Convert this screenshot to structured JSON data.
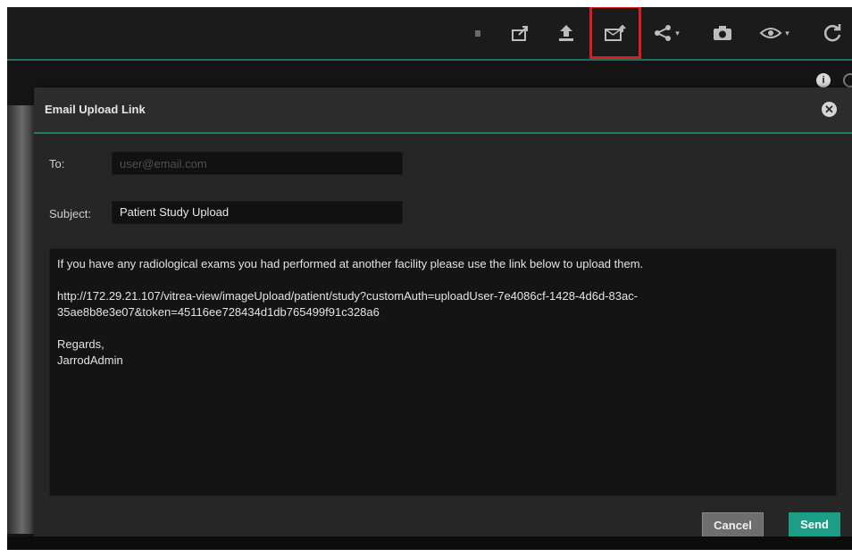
{
  "toolbar": {
    "icons": [
      "dot-icon",
      "export-icon",
      "upload-icon",
      "email-upload-link-icon",
      "share-icon",
      "camera-icon",
      "eye-icon",
      "refresh-icon"
    ],
    "caret": "▾",
    "highlight_color": "#e01b1b"
  },
  "dialog": {
    "title": "Email Upload Link",
    "close_glyph": "✕",
    "to_label": "To:",
    "to_placeholder": "user@email.com",
    "to_value": "",
    "subject_label": "Subject:",
    "subject_value": "Patient Study Upload",
    "body_line1": "If you have any radiological exams you had performed at another facility please use the link below to upload them.",
    "body_link_line1": "http://172.29.21.107/vitrea-view/imageUpload/patient/study?customAuth=uploadUser-7e4086cf-1428-4d6d-83ac-",
    "body_link_line2": "35ae8b8e3e07&token=45116ee728434d1db765499f91c328a6",
    "body_regards": "Regards,",
    "body_signature": "JarrodAdmin",
    "cancel_label": "Cancel",
    "send_label": "Send"
  },
  "side_icons": {
    "info_glyph": "i"
  },
  "colors": {
    "accent": "#1e9d86",
    "header_border": "#1f7a6b",
    "background": "#151515"
  }
}
